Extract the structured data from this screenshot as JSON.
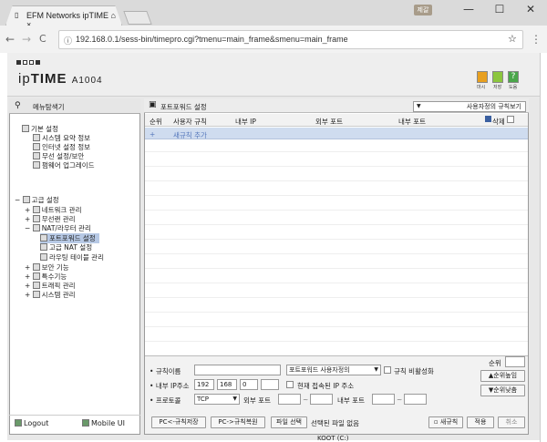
{
  "browser": {
    "tab_title": "EFM Networks ipTIME ⌂ ×",
    "user_badge": "제갈",
    "min_glyph": "—",
    "max_glyph": "☐",
    "close_glyph": "✕",
    "url": "192.168.0.1/sess-bin/timepro.cgi?tmenu=main_frame&smenu=main_frame",
    "back_glyph": "←",
    "forward_glyph": "→",
    "reload_glyph": "C",
    "star_glyph": "☆",
    "menu_glyph": "⋮",
    "info_glyph": "ⓘ"
  },
  "header": {
    "brand_ip": "ip",
    "brand_time": "TIME",
    "brand_model": "A1004",
    "buttons": [
      {
        "label": "마시",
        "color": "#e8a020"
      },
      {
        "label": "저장",
        "color": "#8cc63e"
      },
      {
        "label": "도움",
        "color": "#4aa64a"
      }
    ],
    "help_glyph": "?"
  },
  "sidebar": {
    "title": "메뉴탐색기",
    "basic_group": "기본 설정",
    "basic_items": [
      "시스템 요약 정보",
      "인터넷 설정 정보",
      "무선 설정/보안",
      "펌웨어 업그레이드"
    ],
    "adv_group": "고급 설정",
    "adv_items": [
      {
        "label": "네트워크 관리",
        "sign": "+"
      },
      {
        "label": "무선랜 관리",
        "sign": "+"
      },
      {
        "label": "NAT/라우터 관리",
        "sign": "−"
      }
    ],
    "nat_items": [
      "포트포워드 설정",
      "고급 NAT 설정",
      "라우팅 테이블 관리"
    ],
    "adv_items2": [
      "보안 기능",
      "특수기능",
      "트래픽 관리",
      "시스템 관리"
    ],
    "logout": "Logout",
    "mobile": "Mobile UI"
  },
  "main": {
    "title": "포트포워드 설정",
    "view_select": "사용자정의 규칙보기",
    "columns": [
      "순위",
      "사용자 규칙",
      "내부 IP",
      "외부 포트",
      "내부 포트",
      "삭제"
    ],
    "new_rule_plus": "+",
    "new_rule": "새규칙 추가"
  },
  "form": {
    "rule_name_label": "규칙이름",
    "rule_name_value": "",
    "rule_type": "포트포워드 사용자정의",
    "disable_label": "규칙 비활성화",
    "internal_ip_label": "내부 IP주소",
    "ip": [
      "192",
      "168",
      "0",
      ""
    ],
    "current_ip_label": "현재 접속된 IP 주소",
    "protocol_label": "프로토콜",
    "protocol_value": "TCP",
    "ext_port_label": "외부 포트",
    "int_port_label": "내부 포트",
    "tilde": "~",
    "rank_label": "순위",
    "rank_up": "▲순위높임",
    "rank_down": "▼순위낮춤",
    "btn_pc_save": "PC<-규칙저장",
    "btn_pc_restore": "PC->규칙복원",
    "btn_file": "파일 선택",
    "no_file": "선택된 파일 없음",
    "btn_new": "새규칙",
    "btn_apply": "적용",
    "btn_cancel": "취소"
  },
  "taskbar_hint": "KOOT (C:)"
}
